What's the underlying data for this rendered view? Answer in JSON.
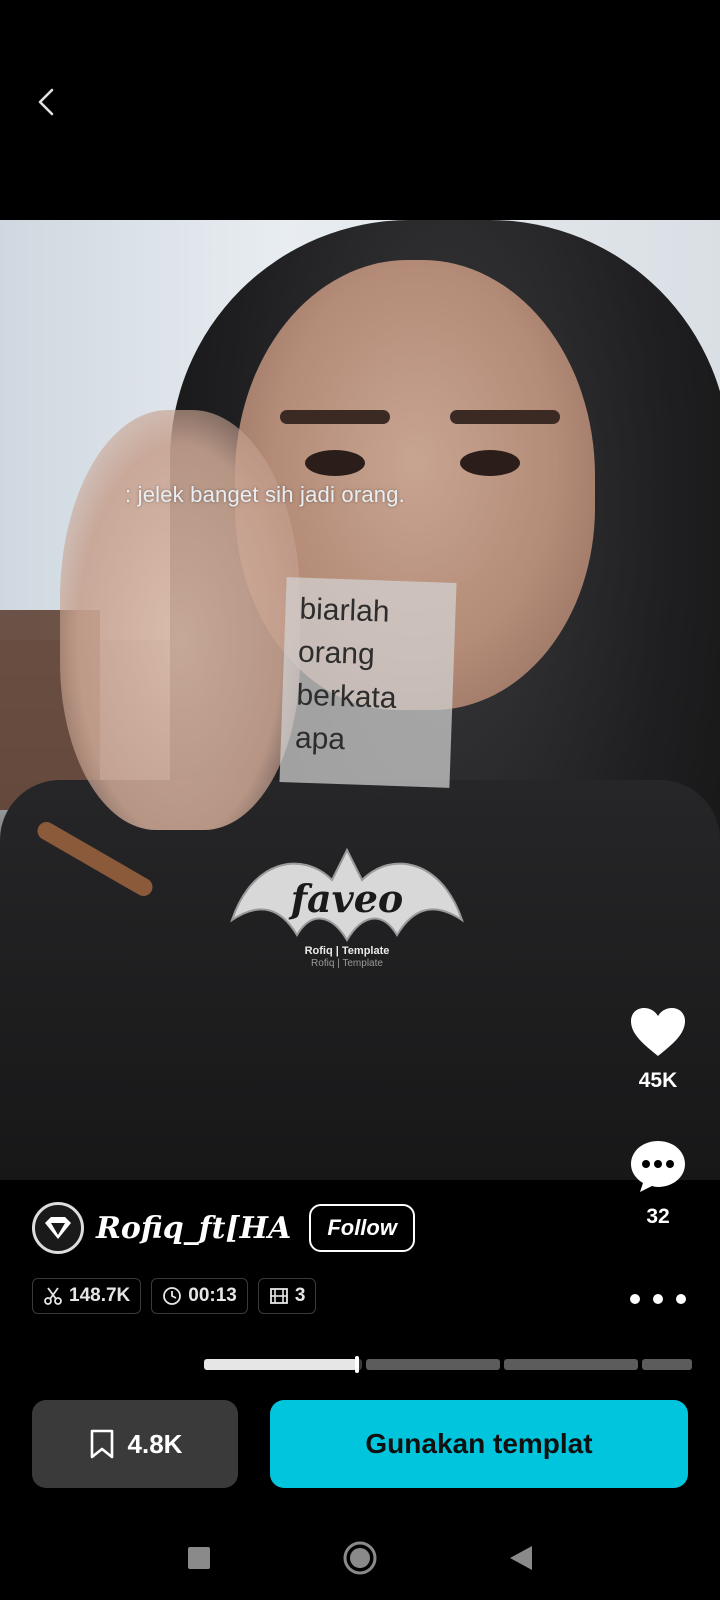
{
  "video": {
    "caption_text": ": jelek banget sih jadi orang.",
    "note_lines": [
      "biarlah",
      "orang",
      "berkata",
      "apa"
    ],
    "emblem_caption": "Rofiq | Template"
  },
  "actions": {
    "likes": "45K",
    "comments": "32"
  },
  "author": {
    "name": "Rofiq_ft[HA",
    "follow_label": "Follow"
  },
  "stats": {
    "uses": "148.7K",
    "duration": "00:13",
    "clips": "3"
  },
  "progress": {
    "segments": 4,
    "active_segment": 1,
    "active_fraction": 0.97
  },
  "bottom": {
    "saves": "4.8K",
    "use_template_label": "Gunakan templat"
  },
  "colors": {
    "accent": "#00c5dd",
    "background": "#000000",
    "save_button": "#3a3a3a"
  },
  "icons": {
    "back": "chevron-left-icon",
    "like": "heart-icon",
    "comment": "comment-bubble-icon",
    "uses": "scissors-icon",
    "duration": "clock-icon",
    "clips": "film-icon",
    "save": "bookmark-icon",
    "more": "more-dots-icon"
  }
}
